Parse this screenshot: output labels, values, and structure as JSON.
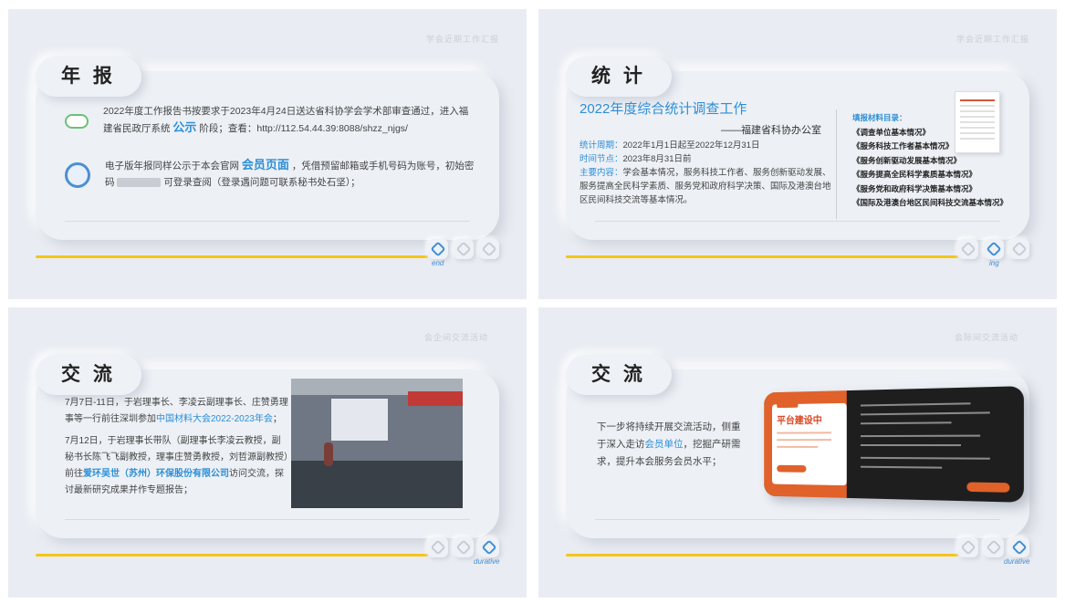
{
  "slides": {
    "s1": {
      "corner": "学会近期工作汇报",
      "title": "年 报",
      "row1": {
        "t1": "2022年度工作报告书按要求于2023年4月24日送达省科协学会学术部审查通过，进入福建省民政厅系统",
        "highlight": "公示",
        "t2": "阶段；查看：http://112.54.44.39:8088/shzz_njgs/"
      },
      "row2": {
        "t1": "电子版年报同样公示于本会官网",
        "highlight": "会员页面",
        "t2": "，凭借预留邮箱或手机号码为账号，初始密码",
        "t3": "可登录查阅（登录遇问题可联系秘书处石坚）；"
      },
      "nav_label": "end"
    },
    "s2": {
      "corner": "学会近期工作汇报",
      "title": "统 计",
      "heading": "2022年度综合统计调查工作",
      "org": "——福建省科协办公室",
      "period_label": "统计周期：",
      "period": "2022年1月1日起至2022年12月31日",
      "time_label": "时间节点：",
      "time": "2023年8月31日前",
      "content_label": "主要内容：",
      "content": "学会基本情况，服务科技工作者、服务创新驱动发展、服务提高全民科学素质、服务党和政府科学决策、国际及港澳台地区民间科技交流等基本情况。",
      "list_head": "填报材料目录：",
      "list": [
        "《调查单位基本情况》",
        "《服务科技工作者基本情况》",
        "《服务创新驱动发展基本情况》",
        "《服务提高全民科学素质基本情况》",
        "《服务党和政府科学决策基本情况》",
        "《国际及港澳台地区民间科技交流基本情况》"
      ],
      "nav_label": "ing"
    },
    "s3": {
      "corner": "会企间交流活动",
      "title": "交 流",
      "p1a": "7月7日-11日，于岩理事长、李凌云副理事长、庄赞勇理事等一行前往深圳参加",
      "p1h": "中国材料大会2022-2023年会",
      "p1b": "；",
      "p2a": "7月12日，于岩理事长带队（副理事长李凌云教授，副秘书长陈飞飞副教授，理事庄赞勇教授，刘哲源副教授）前往",
      "p2h": "爱环吴世（苏州）环保股份有限公司",
      "p2b": "访问交流，探讨最新研究成果并作专题报告；",
      "nav_label": "durative"
    },
    "s4": {
      "corner": "会际间交流活动",
      "title": "交 流",
      "b1": "下一步将持续开展交流活动，侧重于深入走访",
      "bh": "会员单位",
      "b2": "，挖掘产研需求，提升本会服务会员水平；",
      "card_title": "平台建设中",
      "nav_label": "durative"
    }
  }
}
